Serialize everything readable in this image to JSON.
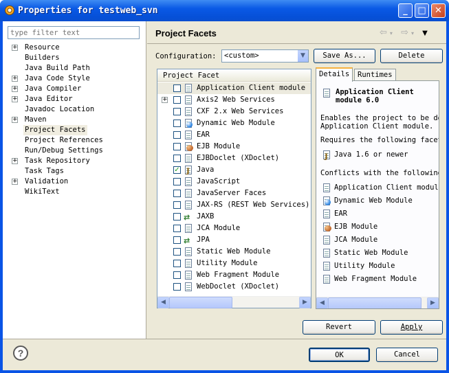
{
  "window": {
    "title": "Properties for testweb_svn",
    "minimize": "_",
    "maximize": "□",
    "close": "✕"
  },
  "filter": {
    "placeholder": "type filter text"
  },
  "tree": [
    {
      "label": "Resource",
      "expandable": true
    },
    {
      "label": "Builders",
      "expandable": false
    },
    {
      "label": "Java Build Path",
      "expandable": false
    },
    {
      "label": "Java Code Style",
      "expandable": true
    },
    {
      "label": "Java Compiler",
      "expandable": true
    },
    {
      "label": "Java Editor",
      "expandable": true
    },
    {
      "label": "Javadoc Location",
      "expandable": false
    },
    {
      "label": "Maven",
      "expandable": true
    },
    {
      "label": "Project Facets",
      "expandable": false,
      "selected": true
    },
    {
      "label": "Project References",
      "expandable": false
    },
    {
      "label": "Run/Debug Settings",
      "expandable": false
    },
    {
      "label": "Task Repository",
      "expandable": true
    },
    {
      "label": "Task Tags",
      "expandable": false
    },
    {
      "label": "Validation",
      "expandable": true
    },
    {
      "label": "WikiText",
      "expandable": false
    }
  ],
  "page": {
    "title": "Project Facets",
    "nav_back": "⇦",
    "nav_forward": "⇨",
    "menu": "▼"
  },
  "configuration": {
    "label": "Configuration:",
    "value": "<custom>",
    "save_as": "Save As...",
    "delete": "Delete"
  },
  "facets": {
    "header": "Project Facet",
    "items": [
      {
        "label": "Application Client module",
        "checked": false,
        "icon": "document-icon",
        "highlight": true
      },
      {
        "label": "Axis2 Web Services",
        "checked": false,
        "icon": "document-icon",
        "expandable": true
      },
      {
        "label": "CXF 2.x Web Services",
        "checked": false,
        "icon": "document-icon"
      },
      {
        "label": "Dynamic Web Module",
        "checked": false,
        "icon": "globe-icon"
      },
      {
        "label": "EAR",
        "checked": false,
        "icon": "document-icon"
      },
      {
        "label": "EJB Module",
        "checked": false,
        "icon": "bean-icon"
      },
      {
        "label": "EJBDoclet (XDoclet)",
        "checked": false,
        "icon": "document-icon"
      },
      {
        "label": "Java",
        "checked": true,
        "icon": "java-icon"
      },
      {
        "label": "JavaScript",
        "checked": false,
        "icon": "document-icon"
      },
      {
        "label": "JavaServer Faces",
        "checked": false,
        "icon": "document-icon"
      },
      {
        "label": "JAX-RS (REST Web Services)",
        "checked": false,
        "icon": "document-icon"
      },
      {
        "label": "JAXB",
        "checked": false,
        "icon": "arrows-icon"
      },
      {
        "label": "JCA Module",
        "checked": false,
        "icon": "document-icon"
      },
      {
        "label": "JPA",
        "checked": false,
        "icon": "arrows-icon"
      },
      {
        "label": "Static Web Module",
        "checked": false,
        "icon": "document-icon"
      },
      {
        "label": "Utility Module",
        "checked": false,
        "icon": "document-icon"
      },
      {
        "label": "Web Fragment Module",
        "checked": false,
        "icon": "document-icon"
      },
      {
        "label": "WebDoclet (XDoclet)",
        "checked": false,
        "icon": "document-icon"
      }
    ]
  },
  "tabs": {
    "details": "Details",
    "runtimes": "Runtimes"
  },
  "details": {
    "title_line1": "Application Client",
    "title_line2": "module 6.0",
    "desc_line1": "Enables the project to be de",
    "desc_line2": "Application Client module.",
    "requires_label": "Requires the following facet",
    "requires": [
      {
        "label": "Java 1.6 or newer",
        "icon": "java-icon"
      }
    ],
    "conflicts_label": "Conflicts with the following",
    "conflicts": [
      {
        "label": "Application Client modul",
        "icon": "document-icon"
      },
      {
        "label": "Dynamic Web Module",
        "icon": "globe-icon"
      },
      {
        "label": "EAR",
        "icon": "document-icon"
      },
      {
        "label": "EJB Module",
        "icon": "bean-icon"
      },
      {
        "label": "JCA Module",
        "icon": "document-icon"
      },
      {
        "label": "Static Web Module",
        "icon": "document-icon"
      },
      {
        "label": "Utility Module",
        "icon": "document-icon"
      },
      {
        "label": "Web Fragment Module",
        "icon": "document-icon"
      }
    ]
  },
  "buttons": {
    "revert": "Revert",
    "apply": "Apply",
    "ok": "OK",
    "cancel": "Cancel",
    "help": "?"
  }
}
